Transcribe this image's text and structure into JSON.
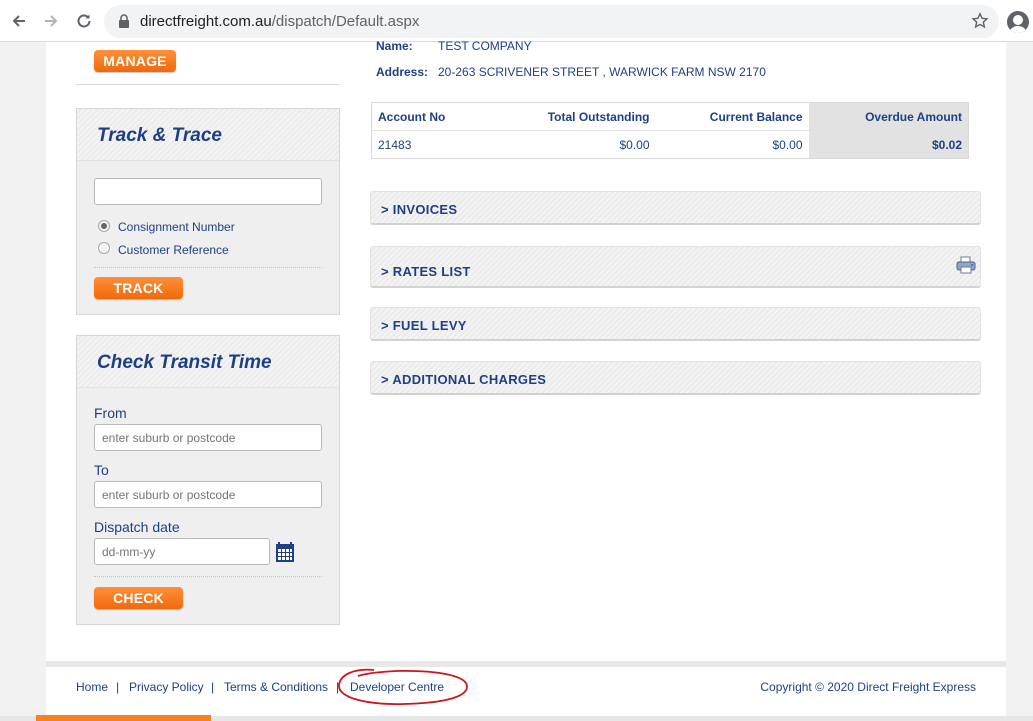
{
  "browser": {
    "url_domain": "directfreight.com.au",
    "url_path": "/dispatch/Default.aspx"
  },
  "sidebar": {
    "manage_label": "MANAGE",
    "track_trace": {
      "title": "Track & Trace",
      "input_value": "",
      "radio_options": [
        "Consignment Number",
        "Customer Reference"
      ],
      "selected_option": "Consignment Number",
      "button_label": "TRACK"
    },
    "transit": {
      "title": "Check Transit Time",
      "from_label": "From",
      "from_placeholder": "enter suburb or postcode",
      "to_label": "To",
      "to_placeholder": "enter suburb or postcode",
      "date_label": "Dispatch date",
      "date_placeholder": "dd-mm-yy",
      "button_label": "CHECK"
    }
  },
  "account": {
    "name_label": "Name:",
    "name_value": "TEST COMPANY",
    "address_label": "Address:",
    "address_value": "20-263 SCRIVENER STREET , WARWICK FARM NSW 2170",
    "table": {
      "headers": [
        "Account No",
        "Total Outstanding",
        "Current Balance",
        "Overdue Amount"
      ],
      "row": [
        "21483",
        "$0.00",
        "$0.00",
        "$0.02"
      ]
    }
  },
  "sections": [
    {
      "label": "> INVOICES"
    },
    {
      "label": "> RATES LIST"
    },
    {
      "label": "> FUEL LEVY"
    },
    {
      "label": "> ADDITIONAL CHARGES"
    }
  ],
  "footer": {
    "links": [
      "Home",
      "Privacy Policy",
      "Terms & Conditions",
      "Developer Centre"
    ],
    "separator": "|",
    "copyright": "Copyright © 2020 Direct Freight Express"
  },
  "colors": {
    "brand_orange": "#f58220",
    "brand_navy": "#1f3f85",
    "annotation_red": "#d0141c"
  }
}
